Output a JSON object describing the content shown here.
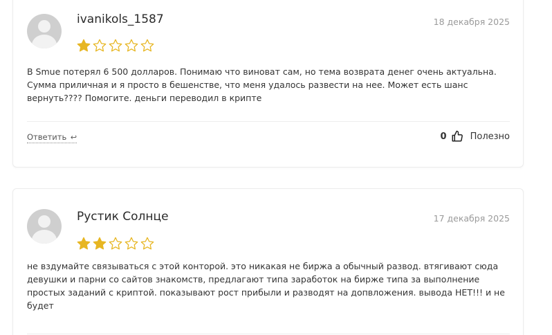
{
  "colors": {
    "star_filled": "#e7b622",
    "star_empty": "#e7b622",
    "avatar_bg": "#cfcfcf",
    "date_text": "#9a9a9a"
  },
  "icons": {
    "star": "star-icon",
    "reply": "reply-arrow-icon",
    "like": "thumbs-up-icon",
    "avatar": "user-avatar-icon"
  },
  "reviews": [
    {
      "username": "ivanikols_1587",
      "date": "18 декабря 2025",
      "rating": 1,
      "max_rating": 5,
      "text": "В Smue потерял 6 500 долларов. Понимаю что виноват сам, но тема возврата денег очень актуальна. Сумма приличная и я просто в бешенстве, что меня удалось развести на нее. Может есть шанс вернуть???? Помогите. деньги переводил в крипте",
      "reply_label": "Ответить",
      "reply_icon": "↩",
      "helpful_count": "0",
      "helpful_label": "Полезно"
    },
    {
      "username": "Рустик Солнце",
      "date": "17 декабря 2025",
      "rating": 2,
      "max_rating": 5,
      "text": "не вздумайте связываться с этой конторой. это никакая не биржа а обычный развод. втягивают сюда девушки и парни со сайтов знакомств, предлагают типа заработок на бирже типа за выполнение простых заданий с криптой. показывают рост прибыли и разводят на допвложения. вывода НЕТ!!! и не будет"
    }
  ]
}
